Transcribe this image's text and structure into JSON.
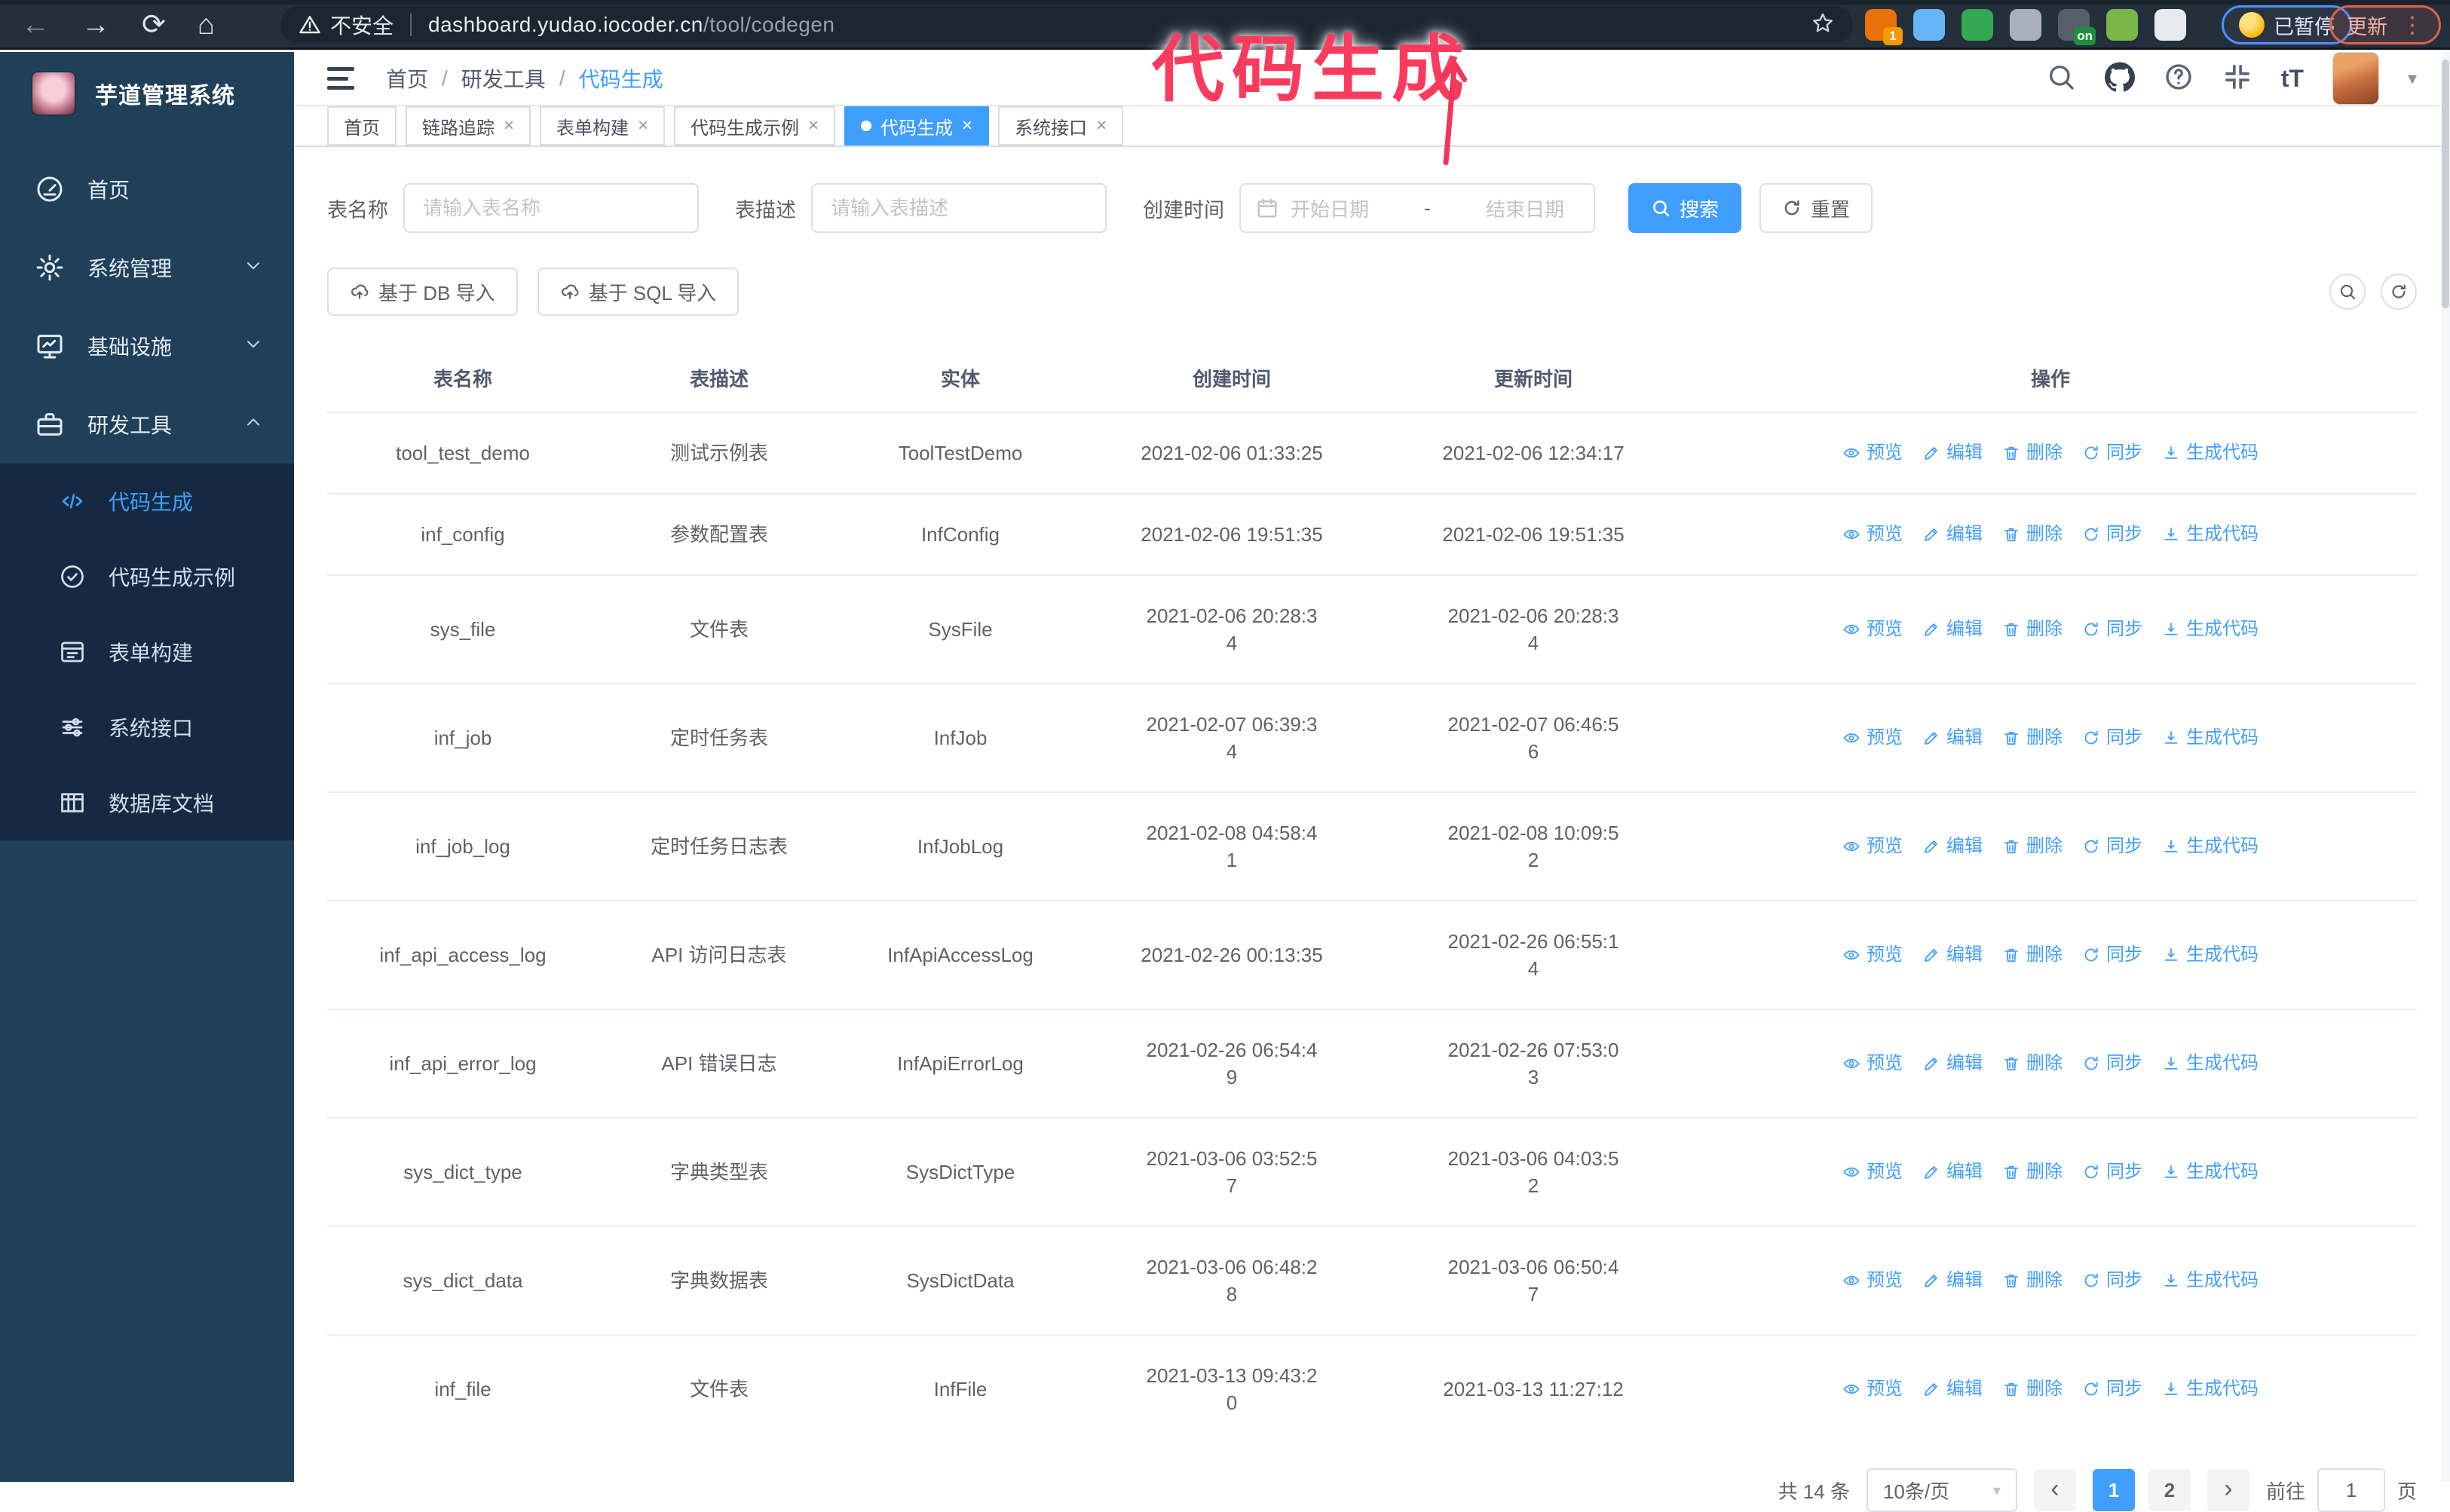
{
  "colors": {
    "accent": "#409eff",
    "sidebar_bg": "#20405a",
    "submenu_bg": "#152a42",
    "annotation": "#fb3b5e",
    "browser_bg": "#242f3c"
  },
  "browser": {
    "security_label": "不安全",
    "url_host": "dashboard.yudao.iocoder.cn",
    "url_path": "/tool/codegen",
    "profile_chip_label": "已暂停",
    "update_chip_label": "更新",
    "extensions": [
      {
        "name": "extension-orange",
        "color": "#e8710a",
        "badge": "1",
        "badge_color": "#f29900"
      },
      {
        "name": "extension-gem",
        "color": "#66b5f8",
        "badge": null,
        "badge_color": null
      },
      {
        "name": "extension-green-check",
        "color": "#34a853",
        "badge": null,
        "badge_color": null
      },
      {
        "name": "extension-gray",
        "color": "#a8b0b9",
        "badge": null,
        "badge_color": null
      },
      {
        "name": "extension-dark",
        "color": "#555f6a",
        "badge": "on",
        "badge_color": "#1e8e3e"
      },
      {
        "name": "extension-monkey",
        "color": "#7ab648",
        "badge": null,
        "badge_color": null
      },
      {
        "name": "extensions-puzzle",
        "color": "#e8eaed",
        "badge": null,
        "badge_color": null
      }
    ]
  },
  "annotation": {
    "title": "代码生成"
  },
  "sidebar": {
    "logo_title": "芋道管理系统",
    "items": [
      {
        "label": "首页",
        "icon": "dashboard",
        "chevron": null
      },
      {
        "label": "系统管理",
        "icon": "gear",
        "chevron": "down"
      },
      {
        "label": "基础设施",
        "icon": "monitor",
        "chevron": "down"
      },
      {
        "label": "研发工具",
        "icon": "toolbox",
        "chevron": "up"
      }
    ],
    "subitems": [
      {
        "label": "代码生成",
        "icon": "code",
        "active": true
      },
      {
        "label": "代码生成示例",
        "icon": "badge-check",
        "active": false
      },
      {
        "label": "表单构建",
        "icon": "form",
        "active": false
      },
      {
        "label": "系统接口",
        "icon": "sliders",
        "active": false
      },
      {
        "label": "数据库文档",
        "icon": "table-grid",
        "active": false
      }
    ]
  },
  "header": {
    "breadcrumb": [
      "首页",
      "研发工具",
      "代码生成"
    ]
  },
  "tabs": [
    {
      "label": "首页",
      "active": false,
      "closable": false
    },
    {
      "label": "链路追踪",
      "active": false,
      "closable": true
    },
    {
      "label": "表单构建",
      "active": false,
      "closable": true
    },
    {
      "label": "代码生成示例",
      "active": false,
      "closable": true
    },
    {
      "label": "代码生成",
      "active": true,
      "closable": true
    },
    {
      "label": "系统接口",
      "active": false,
      "closable": true
    }
  ],
  "filters": {
    "name_label": "表名称",
    "name_placeholder": "请输入表名称",
    "desc_label": "表描述",
    "desc_placeholder": "请输入表描述",
    "time_label": "创建时间",
    "date_start_placeholder": "开始日期",
    "date_separator": "-",
    "date_end_placeholder": "结束日期",
    "search_label": "搜索",
    "reset_label": "重置"
  },
  "toolbar": {
    "import_db_label": "基于 DB 导入",
    "import_sql_label": "基于 SQL 导入"
  },
  "table": {
    "columns": [
      "表名称",
      "表描述",
      "实体",
      "创建时间",
      "更新时间",
      "操作"
    ],
    "actions": [
      "预览",
      "编辑",
      "删除",
      "同步",
      "生成代码"
    ],
    "rows": [
      {
        "name": "tool_test_demo",
        "desc": "测试示例表",
        "entity": "ToolTestDemo",
        "created": "2021-02-06 01:33:25",
        "updated": "2021-02-06 12:34:17",
        "created_wrap": false,
        "updated_wrap": false
      },
      {
        "name": "inf_config",
        "desc": "参数配置表",
        "entity": "InfConfig",
        "created": "2021-02-06 19:51:35",
        "updated": "2021-02-06 19:51:35",
        "created_wrap": false,
        "updated_wrap": false
      },
      {
        "name": "sys_file",
        "desc": "文件表",
        "entity": "SysFile",
        "created": "2021-02-06 20:28:34",
        "updated": "2021-02-06 20:28:34",
        "created_wrap": true,
        "updated_wrap": true
      },
      {
        "name": "inf_job",
        "desc": "定时任务表",
        "entity": "InfJob",
        "created": "2021-02-07 06:39:34",
        "updated": "2021-02-07 06:46:56",
        "created_wrap": true,
        "updated_wrap": true
      },
      {
        "name": "inf_job_log",
        "desc": "定时任务日志表",
        "entity": "InfJobLog",
        "created": "2021-02-08 04:58:41",
        "updated": "2021-02-08 10:09:52",
        "created_wrap": true,
        "updated_wrap": true
      },
      {
        "name": "inf_api_access_log",
        "desc": "API 访问日志表",
        "entity": "InfApiAccessLog",
        "created": "2021-02-26 00:13:35",
        "updated": "2021-02-26 06:55:14",
        "created_wrap": false,
        "updated_wrap": true
      },
      {
        "name": "inf_api_error_log",
        "desc": "API 错误日志",
        "entity": "InfApiErrorLog",
        "created": "2021-02-26 06:54:49",
        "updated": "2021-02-26 07:53:03",
        "created_wrap": true,
        "updated_wrap": true
      },
      {
        "name": "sys_dict_type",
        "desc": "字典类型表",
        "entity": "SysDictType",
        "created": "2021-03-06 03:52:57",
        "updated": "2021-03-06 04:03:52",
        "created_wrap": true,
        "updated_wrap": true
      },
      {
        "name": "sys_dict_data",
        "desc": "字典数据表",
        "entity": "SysDictData",
        "created": "2021-03-06 06:48:28",
        "updated": "2021-03-06 06:50:47",
        "created_wrap": true,
        "updated_wrap": true
      },
      {
        "name": "inf_file",
        "desc": "文件表",
        "entity": "InfFile",
        "created": "2021-03-13 09:43:20",
        "updated": "2021-03-13 11:27:12",
        "created_wrap": true,
        "updated_wrap": false
      }
    ]
  },
  "pagination": {
    "total_label": "共 14 条",
    "page_size_label": "10条/页",
    "pages": [
      "1",
      "2"
    ],
    "active_page": "1",
    "goto_label": "前往",
    "goto_value": "1",
    "page_suffix": "页"
  }
}
